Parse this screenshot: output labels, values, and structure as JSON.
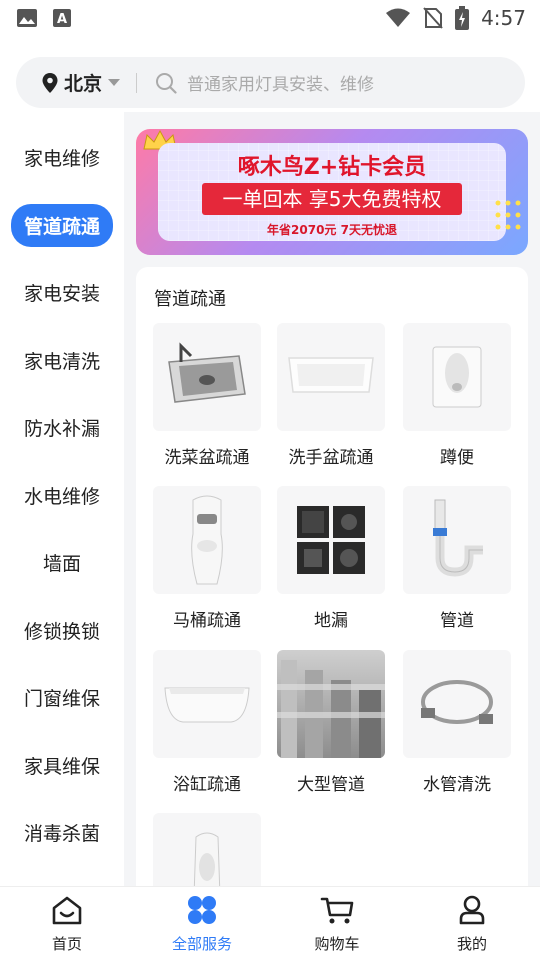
{
  "status_bar": {
    "time": "4:57",
    "icons": [
      "image-icon",
      "a-icon",
      "wifi-icon",
      "no-sim-icon",
      "battery-icon"
    ]
  },
  "search": {
    "location": "北京",
    "placeholder": "普通家用灯具安装、维修"
  },
  "sidebar": {
    "items": [
      {
        "label": "家电维修"
      },
      {
        "label": "管道疏通",
        "active": true
      },
      {
        "label": "家电安装"
      },
      {
        "label": "家电清洗"
      },
      {
        "label": "防水补漏"
      },
      {
        "label": "水电维修"
      },
      {
        "label": "墙面"
      },
      {
        "label": "修锁换锁"
      },
      {
        "label": "门窗维保"
      },
      {
        "label": "家具维保"
      },
      {
        "label": "消毒杀菌"
      }
    ]
  },
  "banner": {
    "title": "啄木鸟Z+钻卡会员",
    "ribbon": "一单回本 享5大免费特权",
    "subtitle": "年省2070元 7天无忧退"
  },
  "category": {
    "title": "管道疏通",
    "items": [
      {
        "label": "洗菜盆疏通",
        "icon": "kitchen-sink-icon"
      },
      {
        "label": "洗手盆疏通",
        "icon": "wash-basin-icon"
      },
      {
        "label": "蹲便",
        "icon": "squat-toilet-icon"
      },
      {
        "label": "马桶疏通",
        "icon": "toilet-icon"
      },
      {
        "label": "地漏",
        "icon": "floor-drain-icon"
      },
      {
        "label": "管道",
        "icon": "pipe-trap-icon"
      },
      {
        "label": "浴缸疏通",
        "icon": "bathtub-icon"
      },
      {
        "label": "大型管道",
        "icon": "large-pipes-icon"
      },
      {
        "label": "水管清洗",
        "icon": "hose-icon"
      },
      {
        "label": "",
        "icon": "urinal-icon"
      }
    ]
  },
  "tabbar": {
    "items": [
      {
        "label": "首页",
        "icon": "home-icon"
      },
      {
        "label": "全部服务",
        "icon": "services-icon",
        "active": true
      },
      {
        "label": "购物车",
        "icon": "cart-icon"
      },
      {
        "label": "我的",
        "icon": "profile-icon"
      }
    ]
  },
  "colors": {
    "accent": "#2f7bf6",
    "banner_red": "#e5283a"
  }
}
